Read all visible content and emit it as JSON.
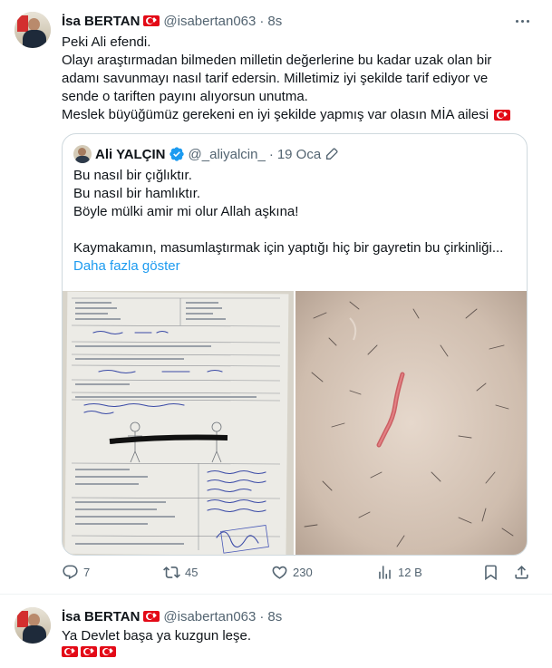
{
  "tweet1": {
    "author_name": "İsa BERTAN",
    "handle": "@isabertan063",
    "separator": "·",
    "time": "8s",
    "text_lines": [
      "Peki Ali efendi.",
      "Olayı araştırmadan bilmeden milletin değerlerine bu kadar uzak olan bir",
      "adamı savunmayı nasıl tarif edersin. Milletimiz iyi şekilde tarif ediyor ve",
      "sende o tariften payını alıyorsun unutma.",
      "Meslek büyüğümüz gerekeni en iyi şekilde yapmış var olasın MİA ailesi"
    ],
    "quote": {
      "author_name": "Ali YALÇIN",
      "handle": "@_aliyalcin_",
      "separator": "·",
      "date": "19 Oca",
      "text_lines": [
        "Bu nasıl bir çığlıktır.",
        "Bu nasıl bir hamlıktır.",
        "Böyle mülki amir mi olur Allah aşkına!",
        "",
        "Kaymakamın, masumlaştırmak için yaptığı hiç bir gayretin bu çirkinliği..."
      ],
      "show_more": "Daha fazla göster"
    },
    "actions": {
      "replies": "7",
      "retweets": "45",
      "likes": "230",
      "views": "12 B"
    }
  },
  "tweet2": {
    "author_name": "İsa BERTAN",
    "handle": "@isabertan063",
    "separator": "·",
    "time": "8s",
    "text": "Ya Devlet başa ya kuzgun leşe."
  },
  "icons": {
    "reply": "reply-icon",
    "retweet": "retweet-icon",
    "like": "heart-icon",
    "views": "views-icon",
    "bookmark": "bookmark-icon",
    "share": "share-icon",
    "more": "more-icon",
    "verified": "verified-badge-icon",
    "edit": "edited-icon",
    "flag": "turkey-flag-icon"
  },
  "colors": {
    "accent": "#1d9bf0",
    "text": "#0f1419",
    "muted": "#536471",
    "border": "#cfd9de",
    "flag_red": "#e30a17"
  }
}
